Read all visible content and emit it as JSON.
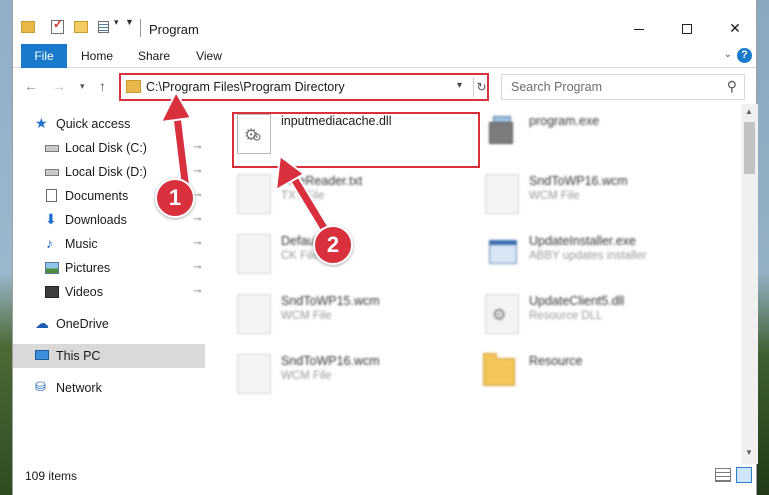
{
  "window": {
    "title": "Program",
    "minimize_icon": "minimize-icon",
    "maximize_icon": "maximize-icon",
    "close_icon": "close-icon",
    "close_glyph": "✕"
  },
  "ribbon": {
    "tabs": [
      {
        "label": "File"
      },
      {
        "label": "Home"
      },
      {
        "label": "Share"
      },
      {
        "label": "View"
      }
    ],
    "expand_glyph": "⌄",
    "help_glyph": "?"
  },
  "address": {
    "path": "C:\\Program Files\\Program Directory",
    "back_glyph": "←",
    "forward_glyph": "→",
    "recent_glyph": "⌄",
    "up_glyph": "↑",
    "dropdown_glyph": "⌄",
    "refresh_glyph": "↻"
  },
  "search": {
    "placeholder": "Search Program",
    "icon_glyph": "⚲"
  },
  "navigation": {
    "items": [
      {
        "label": "Quick access",
        "icon": "star-icon",
        "pinned": false
      },
      {
        "label": "Local Disk (C:)",
        "icon": "drive-icon",
        "pinned": true
      },
      {
        "label": "Local Disk (D:)",
        "icon": "drive-icon",
        "pinned": true
      },
      {
        "label": "Documents",
        "icon": "documents-icon",
        "pinned": true
      },
      {
        "label": "Downloads",
        "icon": "downloads-icon",
        "pinned": true
      },
      {
        "label": "Music",
        "icon": "music-icon",
        "pinned": true
      },
      {
        "label": "Pictures",
        "icon": "pictures-icon",
        "pinned": true
      },
      {
        "label": "Videos",
        "icon": "videos-icon",
        "pinned": true
      },
      {
        "label": "OneDrive",
        "icon": "onedrive-icon",
        "pinned": false
      },
      {
        "label": "This PC",
        "icon": "computer-icon",
        "pinned": false,
        "selected": true
      },
      {
        "label": "Network",
        "icon": "network-icon",
        "pinned": false
      }
    ],
    "pin_glyph": "📌",
    "glyphs": {
      "star": "★",
      "download": "⬇",
      "music": "♪",
      "cloud": "☁",
      "network": "⛁"
    }
  },
  "files": [
    {
      "name": "inputmediacache.dll",
      "type": "",
      "icon": "dll-gear-icon",
      "highlighted": true
    },
    {
      "name": "program.exe",
      "type": "",
      "icon": "application-icon",
      "blurred": true
    },
    {
      "name": "FineReader.txt",
      "type": "TXT File",
      "icon": "text-file-icon",
      "blurred": true
    },
    {
      "name": "SndToWP16.wcm",
      "type": "WCM File",
      "icon": "file-icon",
      "blurred": true
    },
    {
      "name": "Default.jk",
      "type": "CK File",
      "icon": "file-icon",
      "blurred": true
    },
    {
      "name": "UpdateInstaller.exe",
      "type": "ABBY updates installer",
      "icon": "installer-icon",
      "blurred": true
    },
    {
      "name": "SndToWP15.wcm",
      "type": "WCM File",
      "icon": "file-icon",
      "blurred": true
    },
    {
      "name": "UpdateClient5.dll",
      "type": "Resource DLL",
      "icon": "dll-gear-icon",
      "blurred": true
    },
    {
      "name": "SndToWP16.wcm",
      "type": "WCM File",
      "icon": "file-icon",
      "blurred": true
    },
    {
      "name": "Resource",
      "type": "",
      "icon": "folder-icon",
      "blurred": true
    }
  ],
  "status": {
    "item_count": "109 items"
  },
  "annotations": {
    "step1": "1",
    "step2": "2"
  },
  "colors": {
    "accent": "#1979ca",
    "highlight_red": "#d8303d",
    "selected_nav": "#d9d9d9"
  }
}
